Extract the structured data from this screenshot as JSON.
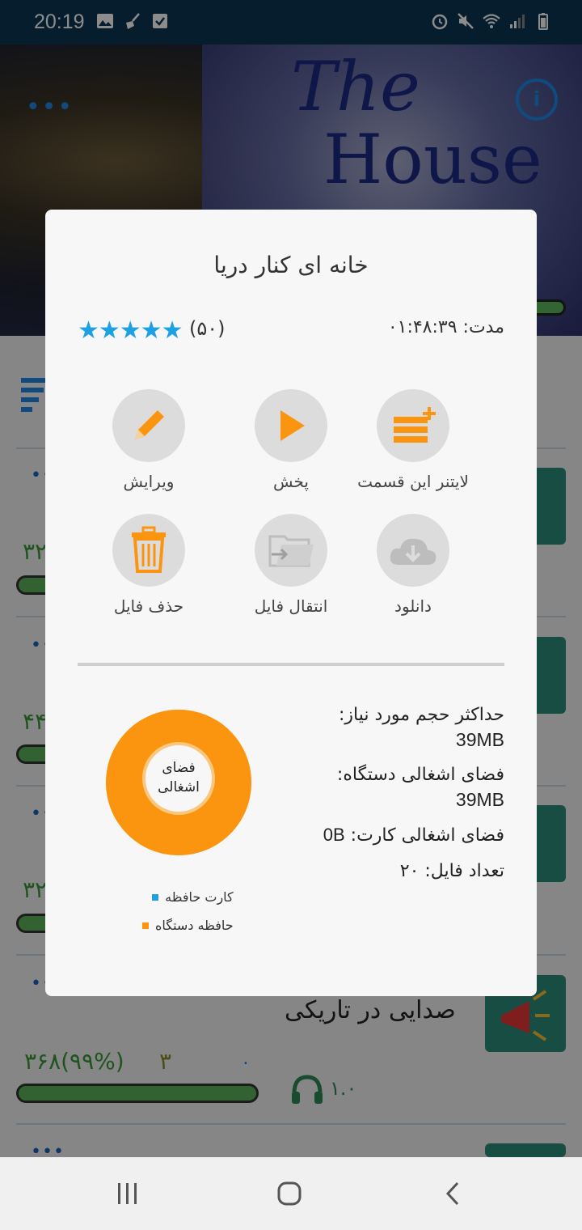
{
  "status_bar": {
    "time": "20:19"
  },
  "header": {
    "art_text_line1": "The",
    "art_text_line2": "House",
    "dots": "•••"
  },
  "list": {
    "rows": [
      {
        "count": "۳۲"
      },
      {
        "count": "۴۴"
      },
      {
        "count": "۳۲"
      }
    ],
    "visible_row": {
      "title": "صدایی در تاریکی",
      "stats": "۳۶۸(۹۹%)",
      "three": "۳",
      "zero": "۰",
      "speed": "۱.۰"
    }
  },
  "dialog": {
    "title": "خانه ای کنار دریا",
    "rating_stars": "★★★★★",
    "rating_count": "(۵۰)",
    "duration": "مدت: ۰۱:۴۸:۳۹",
    "actions": [
      {
        "label": "لایتنر این قسمت",
        "icon": "add-to-leitner-icon"
      },
      {
        "label": "پخش",
        "icon": "play-icon"
      },
      {
        "label": "ویرایش",
        "icon": "pencil-icon"
      },
      {
        "label": "دانلود",
        "icon": "cloud-download-icon"
      },
      {
        "label": "انتقال فایل",
        "icon": "folder-move-icon"
      },
      {
        "label": "حذف فایل",
        "icon": "trash-icon"
      }
    ],
    "stats": {
      "max_size_label": "حداکثر حجم مورد نیاز:",
      "max_size_value": "39MB",
      "device_usage_label": "فضای اشغالی دستگاه:",
      "device_usage_value": "39MB",
      "card_usage_label": "فضای اشغالی کارت:",
      "card_usage_value": "0B",
      "file_count_label": "تعداد فایل:",
      "file_count_value": "۲۰"
    },
    "donut_label_line1": "فضای",
    "donut_label_line2": "اشغالی",
    "legend": [
      {
        "label": "کارت حافظه",
        "color": "#1da1e3"
      },
      {
        "label": "حافظه دستگاه",
        "color": "#fb9510"
      }
    ]
  },
  "chart_data": {
    "type": "pie",
    "title": "فضای اشغالی",
    "categories": [
      "کارت حافظه",
      "حافظه دستگاه"
    ],
    "values": [
      0,
      39
    ],
    "colors": [
      "#1da1e3",
      "#fb9510"
    ]
  },
  "colors": {
    "accent": "#fb9510",
    "primary": "#1da1e3",
    "status_bar": "#0b3553"
  }
}
